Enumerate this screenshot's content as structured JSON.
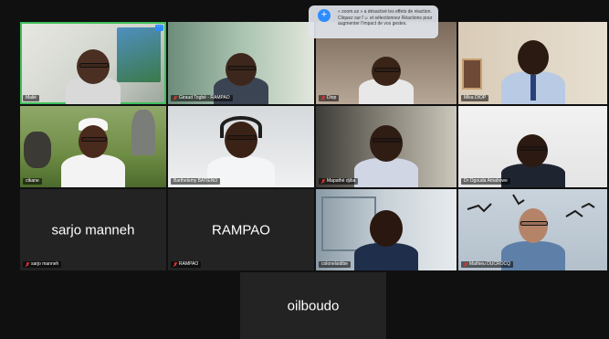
{
  "participants": [
    {
      "name": "Malié",
      "muted": false
    },
    {
      "name": "Giraud Togbé - RAMPAO",
      "muted": true
    },
    {
      "name": "Diop",
      "muted": true
    },
    {
      "name": "Mika DIOP",
      "muted": false
    },
    {
      "name": "ctkane",
      "muted": false
    },
    {
      "name": "Barthelemy BATIENO",
      "muted": true
    },
    {
      "name": "Mapathé djiba",
      "muted": true
    },
    {
      "name": "Dr Ogouda Amahowe",
      "muted": false
    },
    {
      "name": "sarjo manneh",
      "muted": true,
      "display": "sarjo manneh"
    },
    {
      "name": "RAMPAO",
      "muted": true,
      "display": "RAMPAO"
    },
    {
      "name": "colonelsidibe",
      "muted": false
    },
    {
      "name": "Mathieu DUCROCQ",
      "muted": true
    },
    {
      "name": "oilboudo",
      "muted": false,
      "display": "oilboudo"
    }
  ],
  "tooltip": {
    "icon": "reaction-plus-icon",
    "text": "« zoom.us » a désactivé les effets de réaction. Cliquez sur l'☺ et sélectionnez Réactions pour augmenter l'impact de vos gestes."
  },
  "more_badge": "···",
  "colors": {
    "active_speaker": "#3fbf5a",
    "muted": "#e0302a",
    "accent": "#2d8cff"
  }
}
